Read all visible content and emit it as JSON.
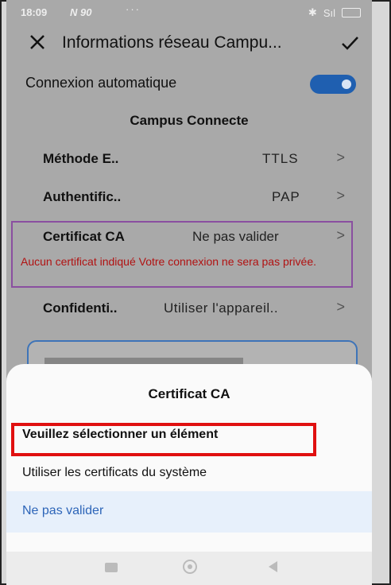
{
  "status": {
    "time": "18:09",
    "net": "N",
    "net_extra": "90",
    "dots": "···",
    "signal": "Sıl"
  },
  "appbar": {
    "title": "Informations réseau Campu..."
  },
  "auto_connect": {
    "label": "Connexion automatique",
    "enabled": true
  },
  "section": {
    "title": "Campus Connecte"
  },
  "items": [
    {
      "label": "Méthode E..",
      "value": "TTLS"
    },
    {
      "label": "Authentific..",
      "value": "PAP"
    },
    {
      "label": "Certificat CA",
      "value": "Ne pas valider"
    },
    {
      "label": "Confidenti..",
      "value": "Utiliser l'appareil.."
    }
  ],
  "error": "Aucun certificat indiqué Votre connexion ne sera pas privée.",
  "sheet": {
    "title": "Certificat CA",
    "options": [
      "Veuillez sélectionner un élément",
      "Utiliser les certificats du système",
      "Ne pas valider"
    ]
  },
  "colors": {
    "toggle": "#1f5fb0",
    "highlight": "#e01010",
    "cert_outline": "#8a4fa0",
    "selected_text": "#2d65b8"
  }
}
